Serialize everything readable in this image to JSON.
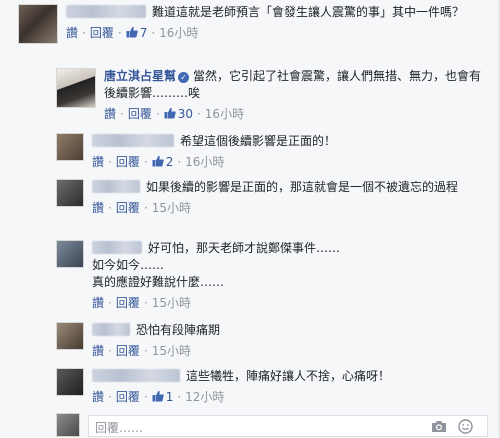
{
  "comments": [
    {
      "author": "",
      "text": "難道這就是老師預言「會發生讓人震驚的事」其中一件嗎？",
      "actions": {
        "like": "讚",
        "reply": "回覆",
        "likes": "7",
        "time": "16小時"
      }
    },
    {
      "author": "唐立淇占星幫",
      "text": "當然，它引起了社會震驚，讓人們無措、無力，也會有後續影響………唉",
      "actions": {
        "like": "讚",
        "reply": "回覆",
        "likes": "30",
        "time": "16小時"
      }
    },
    {
      "author": "",
      "text": "希望這個後續影響是正面的！",
      "actions": {
        "like": "讚",
        "reply": "回覆",
        "likes": "2",
        "time": "16小時"
      }
    },
    {
      "author": "",
      "text": "如果後續的影響是正面的，那這就會是一個不被遺忘的過程",
      "actions": {
        "like": "讚",
        "reply": "回覆",
        "time": "15小時"
      }
    },
    {
      "author": "",
      "text_lines": [
        "好可怕，那天老師才說鄭傑事件……",
        "如今如今……",
        "真的應證好難說什麼……"
      ],
      "actions": {
        "like": "讚",
        "reply": "回覆",
        "time": "15小時"
      }
    },
    {
      "author": "",
      "text": "恐怕有段陣痛期",
      "actions": {
        "like": "讚",
        "reply": "回覆",
        "time": "15小時"
      }
    },
    {
      "author": "",
      "text": "這些犧牲，陣痛好讓人不捨，心痛呀！",
      "actions": {
        "like": "讚",
        "reply": "回覆",
        "likes": "1",
        "time": "12小時"
      }
    }
  ],
  "reply_box": {
    "placeholder": "回覆……",
    "camera_icon": "camera-icon",
    "emoji_icon": "smile-icon"
  },
  "colors": {
    "link": "#365899",
    "meta": "#90949c",
    "background": "#f6f7f9"
  }
}
